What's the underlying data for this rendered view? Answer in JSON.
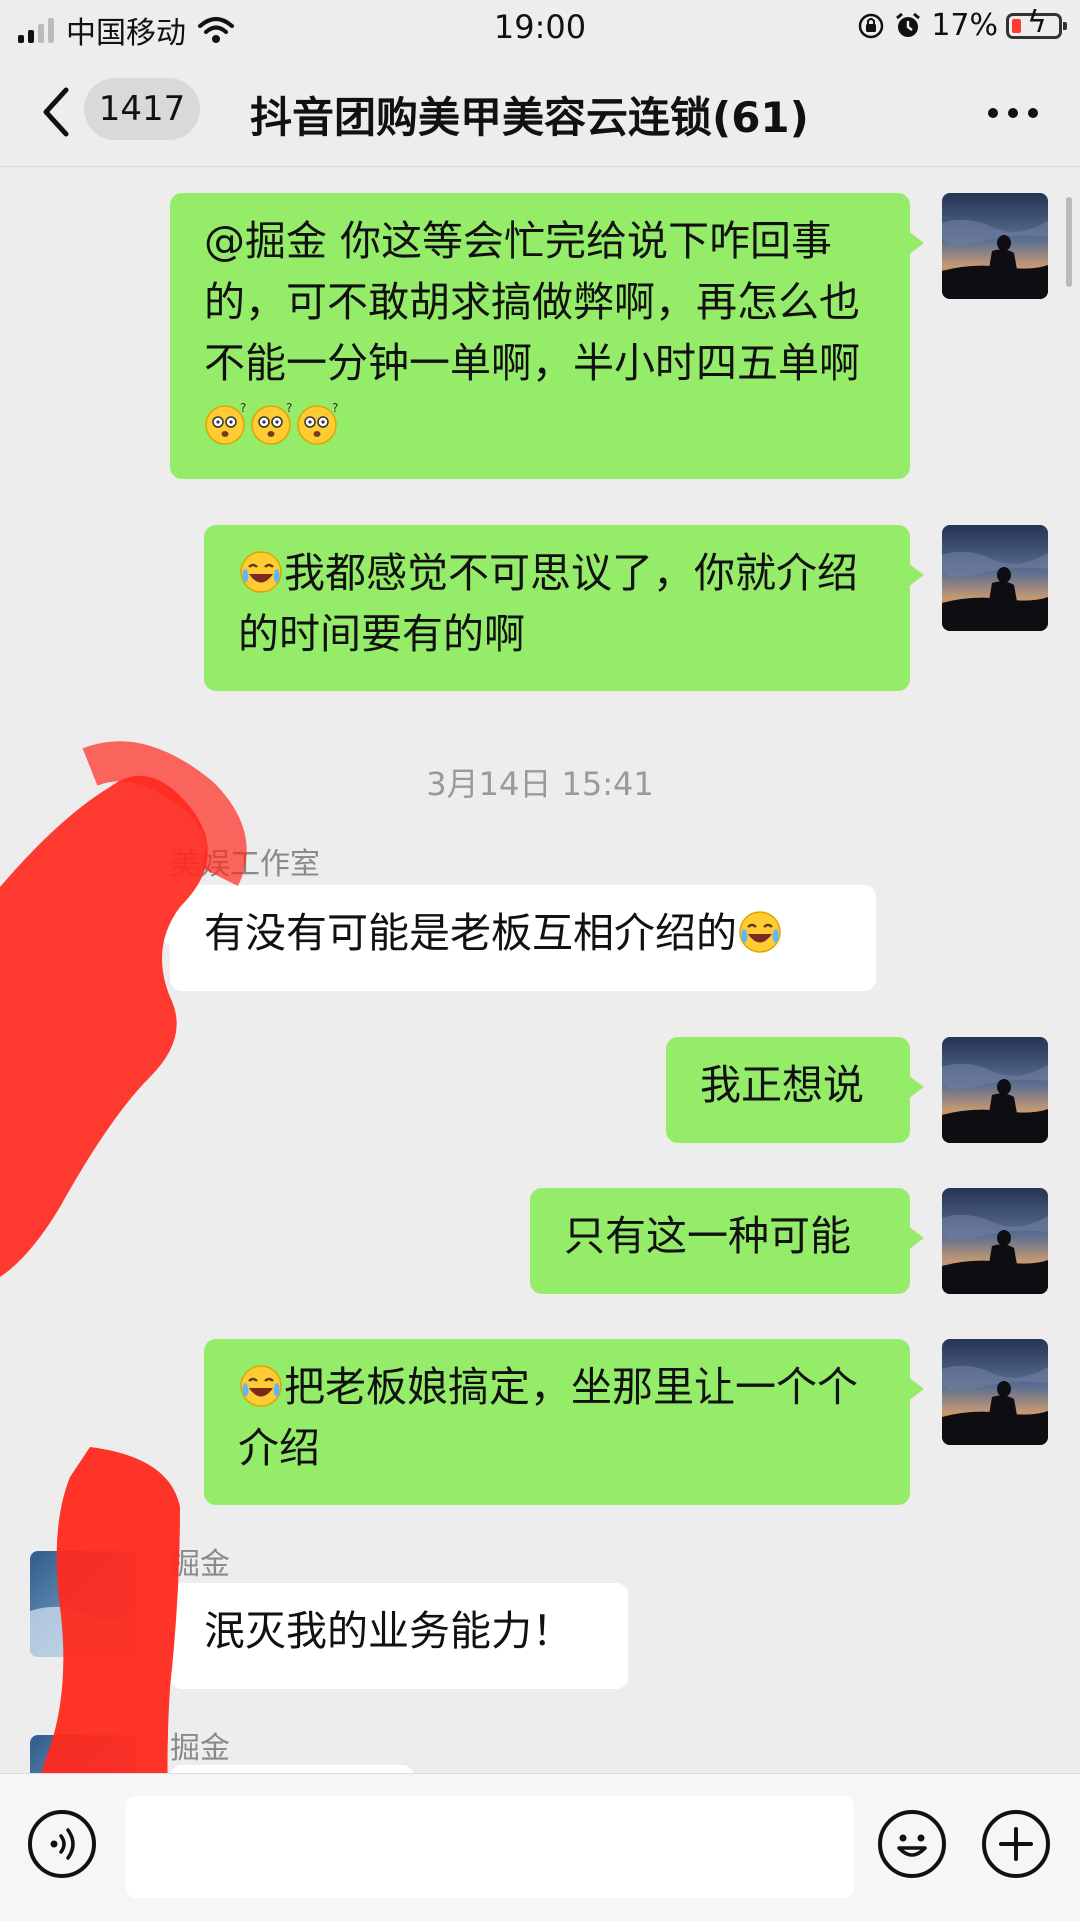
{
  "status_bar": {
    "carrier": "中国移动",
    "time": "19:00",
    "battery": "17%"
  },
  "nav": {
    "unread_count": "1417",
    "title": "抖音团购美甲美容云连锁(61)"
  },
  "messages": [
    {
      "side": "right",
      "text": "@掘金 你这等会忙完给说下咋回事的，可不敢胡求搞做弊啊，再怎么也不能一分钟一单啊，半小时四五单啊",
      "emoji": [
        "dizzy-face-emoji",
        "dizzy-face-emoji",
        "dizzy-face-emoji"
      ]
    },
    {
      "side": "right",
      "emoji_prefix": "face-with-tears-of-joy-emoji",
      "text": "我都感觉不可思议了，你就介绍的时间要有的啊"
    },
    {
      "type": "timestamp",
      "text": "3月14日 15:41"
    },
    {
      "side": "left",
      "sender": "美娱工作室",
      "text": "有没有可能是老板互相介绍的",
      "emoji": [
        "face-with-tears-of-joy-emoji"
      ]
    },
    {
      "side": "right",
      "text": "我正想说"
    },
    {
      "side": "right",
      "text": "只有这一种可能"
    },
    {
      "side": "right",
      "emoji_prefix": "face-with-tears-of-joy-emoji",
      "text": "把老板娘搞定，坐那里让一个个介绍"
    },
    {
      "side": "left",
      "sender": "掘金",
      "text": "泯灭我的业务能力！"
    },
    {
      "side": "left",
      "sender": "掘金",
      "text": ""
    }
  ],
  "colors": {
    "background": "#ededed",
    "self_bubble": "#95ec69",
    "other_bubble": "#ffffff",
    "redaction": "#ff2a1f"
  },
  "icons": [
    "back-arrow-icon",
    "more-icon",
    "voice-icon",
    "emoji-icon",
    "plus-icon",
    "wifi-icon",
    "alarm-icon",
    "orientation-lock-icon"
  ]
}
